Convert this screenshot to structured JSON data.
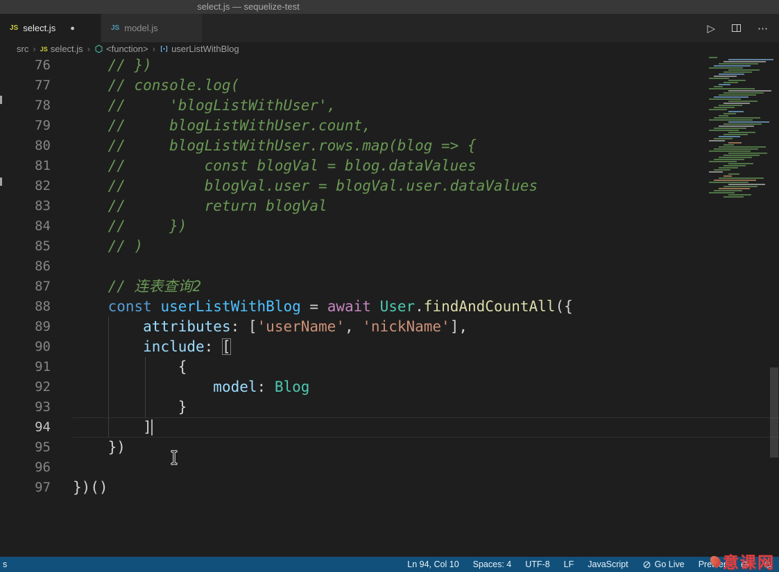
{
  "colors": {
    "editor_bg": "#1e1e1e",
    "status_bg": "#11507a",
    "comment": "#6a9955",
    "keyword": "#569cd6",
    "control": "#c586c0",
    "variable": "#9cdcfe",
    "const_var": "#4fc1ff",
    "class_name": "#4ec9b0",
    "function_name": "#dcdcaa",
    "string": "#ce9178",
    "plain": "#d4d4d4",
    "minimap_palette": [
      "#5c8a50",
      "#6f9ec6",
      "#b5845f",
      "#a8a8a8"
    ]
  },
  "title_bar": {
    "title": "select.js — sequelize-test"
  },
  "tab_bar": {
    "tabs": [
      {
        "label": "select.js",
        "icon": "JS",
        "state": "active",
        "modified": true
      },
      {
        "label": "model.js",
        "icon": "JS",
        "state": "inactive",
        "modified": false
      }
    ],
    "actions": [
      {
        "name": "run",
        "glyph": "▷"
      },
      {
        "name": "split-editor"
      },
      {
        "name": "more-actions",
        "glyph": "⋯"
      }
    ]
  },
  "breadcrumb": {
    "items": [
      {
        "label": "src",
        "icon": null
      },
      {
        "label": "select.js",
        "icon": "js"
      },
      {
        "label": "<function>",
        "icon": "symbol-function"
      },
      {
        "label": "userListWithBlog",
        "icon": "symbol-variable"
      }
    ]
  },
  "editor": {
    "active_line": 94,
    "cursor": {
      "line": 94,
      "col": 10
    },
    "lines": [
      {
        "num": 76,
        "tokens": [
          [
            "    // })",
            "com"
          ]
        ]
      },
      {
        "num": 77,
        "tokens": [
          [
            "    // console.log(",
            "com"
          ]
        ]
      },
      {
        "num": 78,
        "tokens": [
          [
            "    //     'blogListWithUser',",
            "com"
          ]
        ]
      },
      {
        "num": 79,
        "tokens": [
          [
            "    //     blogListWithUser.count,",
            "com"
          ]
        ]
      },
      {
        "num": 80,
        "tokens": [
          [
            "    //     blogListWithUser.rows.map(blog => {",
            "com"
          ]
        ]
      },
      {
        "num": 81,
        "tokens": [
          [
            "    //         const blogVal = blog.dataValues",
            "com"
          ]
        ]
      },
      {
        "num": 82,
        "tokens": [
          [
            "    //         blogVal.user = blogVal.user.dataValues",
            "com"
          ]
        ]
      },
      {
        "num": 83,
        "tokens": [
          [
            "    //         return blogVal",
            "com"
          ]
        ]
      },
      {
        "num": 84,
        "tokens": [
          [
            "    //     })",
            "com"
          ]
        ]
      },
      {
        "num": 85,
        "tokens": [
          [
            "    // )",
            "com"
          ]
        ]
      },
      {
        "num": 86,
        "tokens": []
      },
      {
        "num": 87,
        "tokens": [
          [
            "    // 连表查询2",
            "com"
          ]
        ]
      },
      {
        "num": 88,
        "tokens": [
          [
            "    ",
            "pln"
          ],
          [
            "const",
            "kw"
          ],
          [
            " ",
            "pln"
          ],
          [
            "userListWithBlog",
            "cvar"
          ],
          [
            " = ",
            "pln"
          ],
          [
            "await",
            "ctl"
          ],
          [
            " ",
            "pln"
          ],
          [
            "User",
            "cls"
          ],
          [
            ".",
            "pln"
          ],
          [
            "findAndCountAll",
            "fn"
          ],
          [
            "({",
            "pln"
          ]
        ]
      },
      {
        "num": 89,
        "tokens": [
          [
            "        ",
            "pln"
          ],
          [
            "attributes",
            "var"
          ],
          [
            ": [",
            "pln"
          ],
          [
            "'userName'",
            "str"
          ],
          [
            ", ",
            "pln"
          ],
          [
            "'nickName'",
            "str"
          ],
          [
            "],",
            "pln"
          ]
        ]
      },
      {
        "num": 90,
        "tokens": [
          [
            "        ",
            "pln"
          ],
          [
            "include",
            "var"
          ],
          [
            ": ",
            "pln"
          ],
          [
            "[",
            "match"
          ]
        ]
      },
      {
        "num": 91,
        "tokens": [
          [
            "            {",
            "pln"
          ]
        ]
      },
      {
        "num": 92,
        "tokens": [
          [
            "                ",
            "pln"
          ],
          [
            "model",
            "var"
          ],
          [
            ": ",
            "pln"
          ],
          [
            "Blog",
            "cls"
          ]
        ]
      },
      {
        "num": 93,
        "tokens": [
          [
            "            }",
            "pln"
          ]
        ]
      },
      {
        "num": 94,
        "tokens": [
          [
            "        ]",
            "pln"
          ]
        ]
      },
      {
        "num": 95,
        "tokens": [
          [
            "    })",
            "pln"
          ]
        ]
      },
      {
        "num": 96,
        "tokens": []
      },
      {
        "num": 97,
        "tokens": [
          [
            "})()",
            "pln"
          ]
        ]
      }
    ]
  },
  "status_bar": {
    "left_text": "s",
    "items": [
      "Ln 94, Col 10",
      "Spaces: 4",
      "UTF-8",
      "LF",
      "JavaScript"
    ],
    "go_live_label": "Go Live",
    "prettier_label": "Prettier"
  },
  "watermark": {
    "text": "意课网"
  }
}
